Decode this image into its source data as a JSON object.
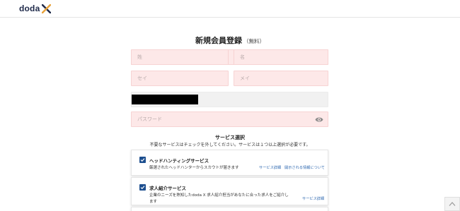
{
  "header": {
    "logo_text": "doda",
    "logo_mark": "X"
  },
  "form": {
    "title": "新規会員登録",
    "title_sub": "（無料）",
    "last_name_placeholder": "姓",
    "first_name_placeholder": "名",
    "last_name_kana_placeholder": "セイ",
    "first_name_kana_placeholder": "メイ",
    "password_placeholder": "パスワード"
  },
  "services": {
    "heading": "サービス選択",
    "note": "不要なサービスはチェックを外してください。サービスは１つ以上選択が必要です。",
    "items": [
      {
        "name": "ヘッドハンティングサービス",
        "description": "厳選されたヘッドハンターからスカウトが届きます",
        "link_detail": "サービス詳細",
        "link_info": "開示される情報について",
        "checked": true
      },
      {
        "name": "求人紹介サービス",
        "description": "企業のニーズを熟知したdoda X 求人紹介担当があなたに合った求人をご紹介します",
        "link_detail": "サービス詳細",
        "checked": true
      }
    ]
  },
  "colors": {
    "accent": "#1d4f8f",
    "field_bg": "#fde8e8",
    "link": "#2e68b0"
  },
  "icons": {
    "password_toggle": "eye-icon",
    "scroll_top": "chevron-up-icon",
    "checkbox": "check-icon"
  }
}
